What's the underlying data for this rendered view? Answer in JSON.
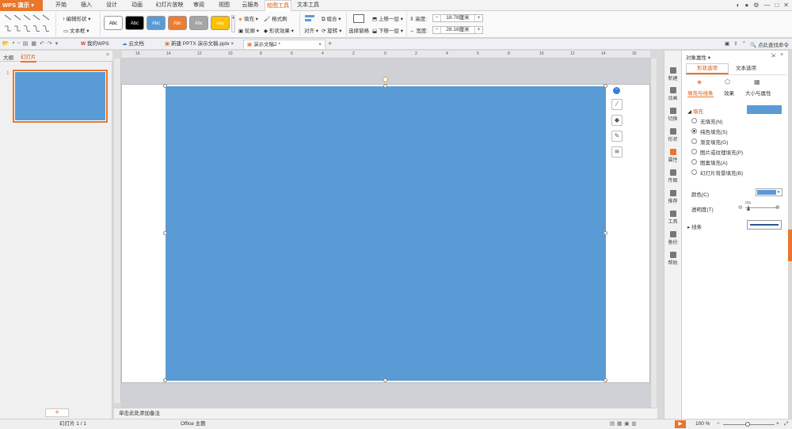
{
  "app": {
    "logo_label": "WPS 演示",
    "accent": "#e9762b"
  },
  "menu": {
    "tabs": [
      "开始",
      "插入",
      "设计",
      "动画",
      "幻灯片放映",
      "审阅",
      "视图",
      "云服务",
      "绘图工具",
      "文本工具"
    ],
    "active_tab": "绘图工具"
  },
  "ribbon": {
    "edit_shape": "编辑形状",
    "text_box": "文本框",
    "styles": [
      {
        "label": "Abc",
        "bg": "#ffffff",
        "fg": "#000000"
      },
      {
        "label": "Abc",
        "bg": "#000000",
        "fg": "#ffffff"
      },
      {
        "label": "Abc",
        "bg": "#5b9bd5",
        "fg": "#ffffff"
      },
      {
        "label": "Abc",
        "bg": "#ed7d31",
        "fg": "#ffffff"
      },
      {
        "label": "Abc",
        "bg": "#a5a5a5",
        "fg": "#ffffff"
      },
      {
        "label": "Abc",
        "bg": "#ffc000",
        "fg": "#ffffff"
      }
    ],
    "fill": "填充",
    "format_painter": "格式刷",
    "outline": "轮廓",
    "shape_effects": "形状效果",
    "align": "对齐",
    "group": "组合",
    "rotate": "旋转",
    "selection_pane": "选择窗格",
    "bring_forward": "上移一层",
    "send_backward": "下移一层",
    "height_label": "高度:",
    "height_value": "18.78厘米",
    "width_label": "宽度:",
    "width_value": "28.16厘米"
  },
  "qat": {
    "tabs": [
      "我的WPS",
      "云文档",
      "新建 PPTX 演示文稿.pptx",
      "演示文稿2 *"
    ],
    "active_tab": "演示文稿2 *",
    "right_label": "点此查找命令"
  },
  "left_pane": {
    "tab_outline": "大纲",
    "tab_slides": "幻灯片",
    "slide_number": "1"
  },
  "ruler": {
    "top_labels": [
      "16",
      "14",
      "12",
      "10",
      "8",
      "6",
      "4",
      "2",
      "0",
      "2",
      "4",
      "6",
      "8",
      "10",
      "12",
      "14",
      "16"
    ]
  },
  "notes": {
    "placeholder": "单击此处添加备注"
  },
  "status": {
    "slide_info": "幻灯片 1 / 1",
    "theme": "Office 主题",
    "zoom": "100 %"
  },
  "side_tools": [
    {
      "label": "新建",
      "icon": "new-icon"
    },
    {
      "label": "动画",
      "icon": "animation-icon"
    },
    {
      "label": "切换",
      "icon": "transition-icon"
    },
    {
      "label": "形状",
      "icon": "shape-icon"
    },
    {
      "label": "属性",
      "icon": "property-icon"
    },
    {
      "label": "传图",
      "icon": "image-icon"
    },
    {
      "label": "推荐",
      "icon": "recommend-icon"
    },
    {
      "label": "工具",
      "icon": "tools-icon"
    },
    {
      "label": "备份",
      "icon": "backup-icon"
    },
    {
      "label": "帮助",
      "icon": "help-icon"
    }
  ],
  "props": {
    "title": "对象属性",
    "tab_shape": "形状选项",
    "tab_text": "文本选项",
    "sub_fill_line": "填充与线条",
    "sub_effects": "效果",
    "sub_size": "大小与属性",
    "fill_section": "填充",
    "fill_color": "#5b9bd5",
    "options": [
      "无填充(N)",
      "纯色填充(S)",
      "渐变填充(G)",
      "图片或纹理填充(P)",
      "图案填充(A)",
      "幻灯片背景填充(B)"
    ],
    "selected_option": "纯色填充(S)",
    "color_label": "颜色(C)",
    "transparency_label": "透明度(T)",
    "transparency_value": "0%",
    "line_section": "线条"
  },
  "shape": {
    "fill": "#5b9bd5"
  }
}
